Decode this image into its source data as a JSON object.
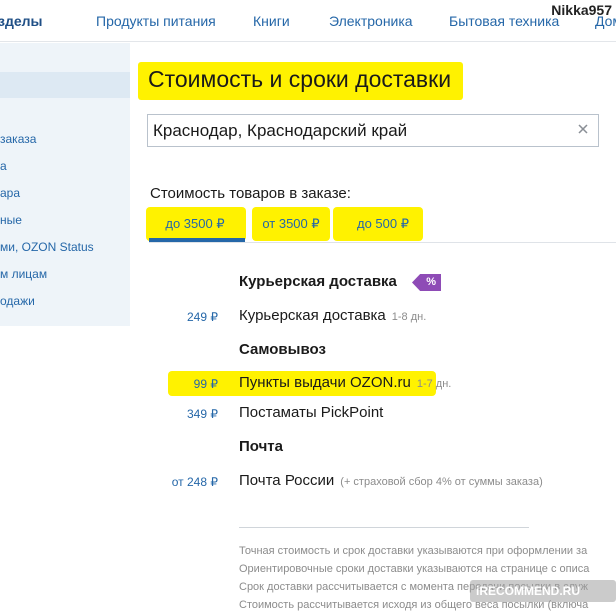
{
  "topnav": {
    "items": [
      "зделы",
      "Продукты питания",
      "Книги",
      "Электроника",
      "Бытовая техника",
      "Дом"
    ]
  },
  "watermark_user": "Nikka957",
  "sidebar": {
    "links": [
      "заказа",
      "а",
      "ара",
      "ные",
      "ми, OZON Status",
      "м лицам",
      "одажи"
    ]
  },
  "page_title": "Стоимость и сроки доставки",
  "city_field": {
    "value": "Краснодар, Краснодарский край"
  },
  "order_label": "Стоимость товаров в заказе:",
  "tabs": [
    {
      "label": "до 3500 ₽",
      "active": true
    },
    {
      "label": "от 3500 ₽",
      "active": false
    },
    {
      "label": "до 500 ₽",
      "active": false
    }
  ],
  "delivery": {
    "courier_title": "Курьерская доставка",
    "promo_badge": "%",
    "courier": {
      "price": "249 ₽",
      "name": "Курьерская доставка",
      "days": "1-8 дн."
    },
    "pickup_title": "Самовывоз",
    "pickup_points": {
      "price": "99 ₽",
      "name": "Пункты выдачи OZON.ru",
      "days": "1-7 дн."
    },
    "postamats": {
      "price": "349 ₽",
      "name": "Постаматы PickPoint"
    },
    "mail_title": "Почта",
    "russian_post": {
      "price": "от 248 ₽",
      "name": "Почта России",
      "note": "(+ страховой сбор 4% от суммы заказа)"
    }
  },
  "notes": [
    "Точная стоимость и срок доставки указываются при оформлении за",
    "Ориентировочные сроки доставки указываются на странице с описа",
    "Срок доставки рассчитывается с момента передачи посылки в служ",
    "Стоимость рассчитывается исходя из общего веса посылки (включа"
  ],
  "stamp": "iRECOMMEND.RU",
  "colors": {
    "link": "#2567a8",
    "highlight": "#fff200",
    "badge": "#8e4bb6",
    "sidebar_bg": "#eef4f9"
  }
}
